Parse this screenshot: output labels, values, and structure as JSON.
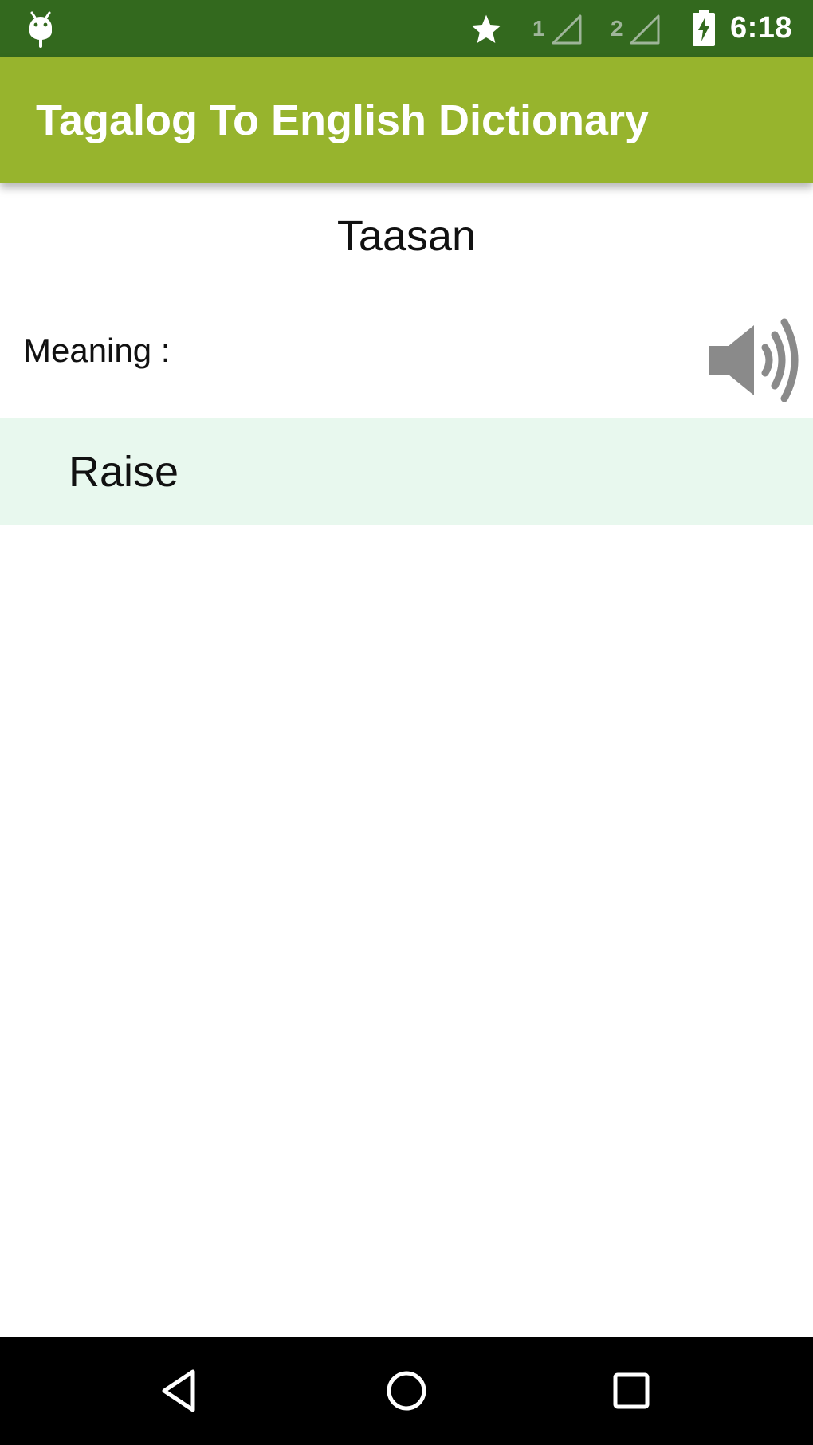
{
  "status_bar": {
    "time": "6:18",
    "sim1_label": "1",
    "sim2_label": "2",
    "icons": [
      "android-icon",
      "star-icon",
      "signal-icon",
      "signal-icon",
      "battery-charging-icon"
    ]
  },
  "app_bar": {
    "title": "Tagalog To English Dictionary"
  },
  "content": {
    "word": "Taasan",
    "meaning_label": "Meaning :",
    "meaning_value": "Raise",
    "speaker_icon": "speaker-icon"
  },
  "nav_bar": {
    "icons": [
      "back-icon",
      "home-icon",
      "recents-icon"
    ]
  },
  "colors": {
    "status_bar": "#33691e",
    "app_bar": "#97b42d",
    "meaning_bg": "#e8f8ee",
    "speaker": "#8a8a8a",
    "nav_bar": "#000000"
  }
}
